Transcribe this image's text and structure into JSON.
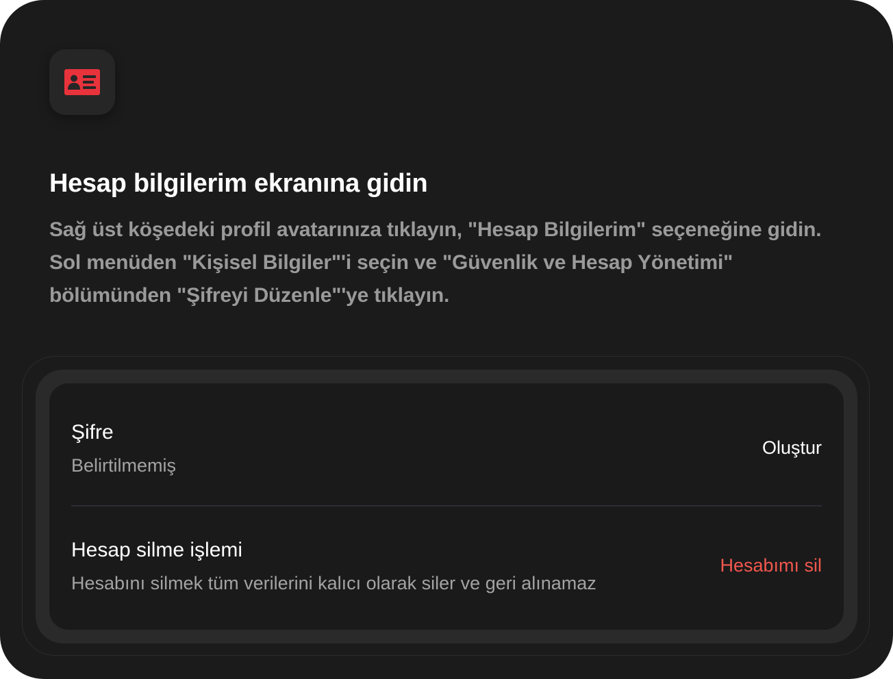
{
  "header": {
    "icon": "id-card-icon",
    "icon_color": "#e8333c",
    "title": "Hesap bilgilerim ekranına gidin",
    "description": "Sağ üst köşedeki profil avatarınıza tıklayın, \"Hesap Bilgilerim\" seçeneğine gidin. Sol menüden \"Kişisel Bilgiler\"'i seçin ve \"Güvenlik ve Hesap Yönetimi\" bölümünden \"Şifreyi Düzenle\"'ye tıklayın."
  },
  "settings": {
    "password": {
      "title": "Şifre",
      "status": "Belirtilmemiş",
      "action_label": "Oluştur"
    },
    "delete_account": {
      "title": "Hesap silme işlemi",
      "description": "Hesabını silmek tüm verilerini kalıcı olarak siler ve geri alınamaz",
      "action_label": "Hesabımı sil",
      "action_color": "#f2574e"
    }
  }
}
